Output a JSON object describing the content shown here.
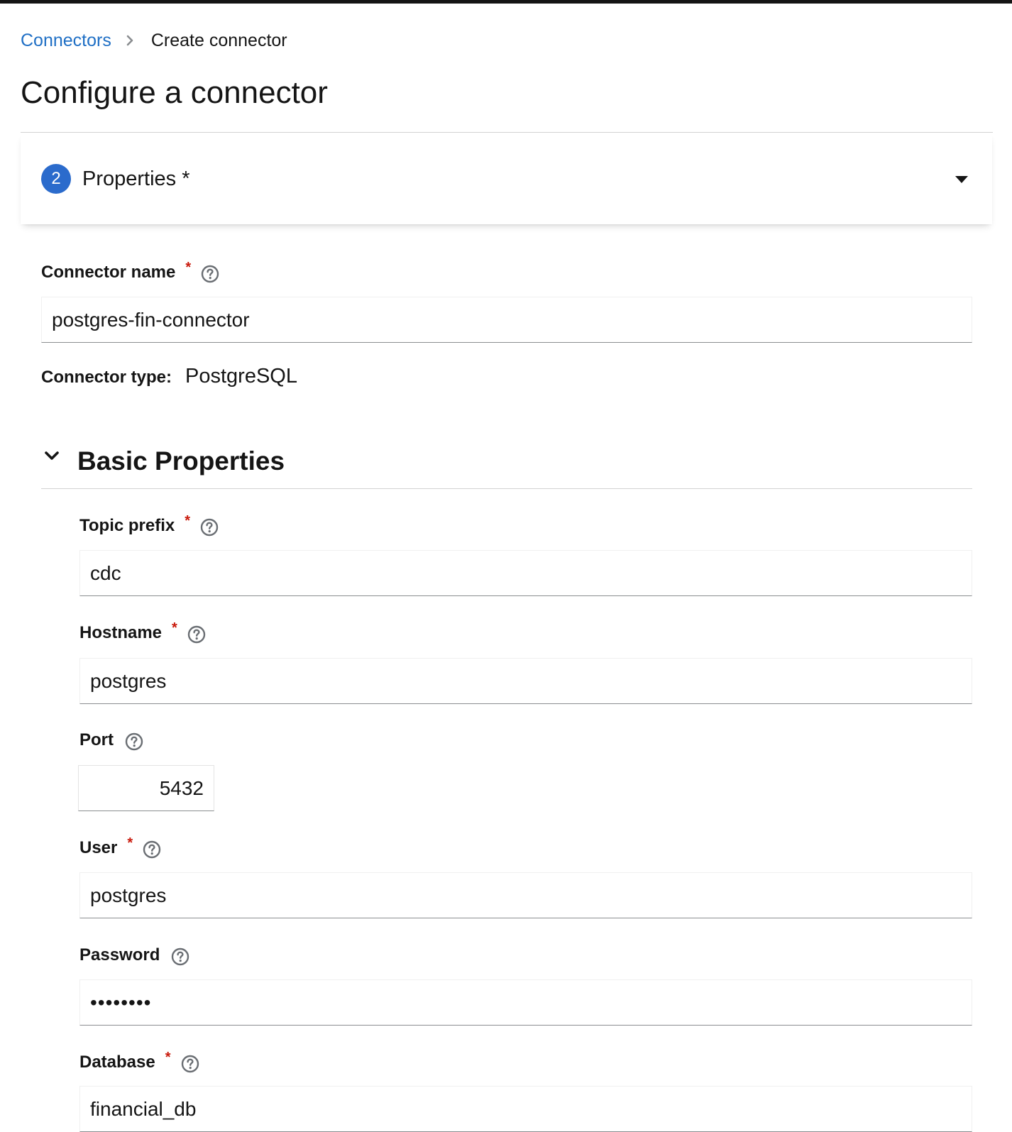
{
  "breadcrumb": {
    "parent": "Connectors",
    "current": "Create connector"
  },
  "page": {
    "title": "Configure a connector"
  },
  "step": {
    "number": "2",
    "title": "Properties *"
  },
  "connector": {
    "name_label": "Connector name",
    "name_value": "postgres-fin-connector",
    "type_label": "Connector type:",
    "type_value": "PostgreSQL"
  },
  "required_marker": "*",
  "basic_properties": {
    "title": "Basic Properties",
    "fields": {
      "topic_prefix": {
        "label": "Topic prefix",
        "value": "cdc"
      },
      "hostname": {
        "label": "Hostname",
        "value": "postgres"
      },
      "port": {
        "label": "Port",
        "value": "5432"
      },
      "user": {
        "label": "User",
        "value": "postgres"
      },
      "password": {
        "label": "Password",
        "value": "••••••••"
      },
      "database": {
        "label": "Database",
        "value": "financial_db"
      }
    }
  },
  "colors": {
    "link": "#1f6fc5",
    "step_badge": "#2b6bcc",
    "required": "#c9190b"
  },
  "icons": {
    "breadcrumb_separator": "chevron-right-icon",
    "step_toggle": "caret-down-icon",
    "section_toggle": "chevron-down-icon",
    "help": "question-circle-icon"
  }
}
